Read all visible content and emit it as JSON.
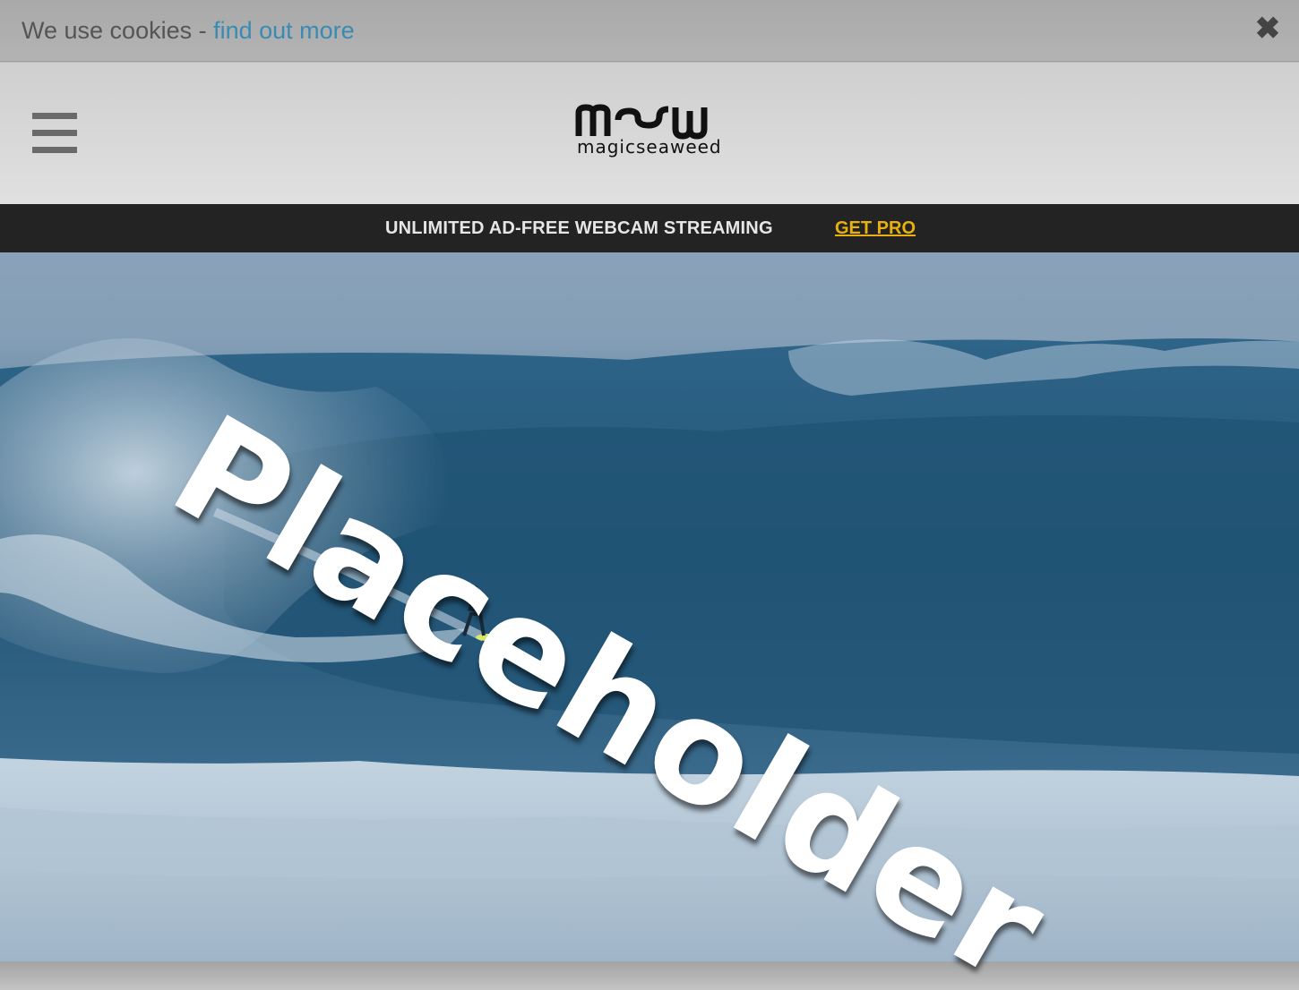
{
  "cookie_bar": {
    "text": "We use cookies - ",
    "link_label": "find out more",
    "close_icon": "close-icon"
  },
  "header": {
    "menu_icon": "hamburger-menu-icon",
    "logo_word": "magicseaweed"
  },
  "promo": {
    "text": "UNLIMITED AD-FREE WEBCAM STREAMING",
    "cta_label": "GET PRO",
    "cta_color": "#e9b10e"
  },
  "watermark": {
    "text": "Placeholder"
  }
}
